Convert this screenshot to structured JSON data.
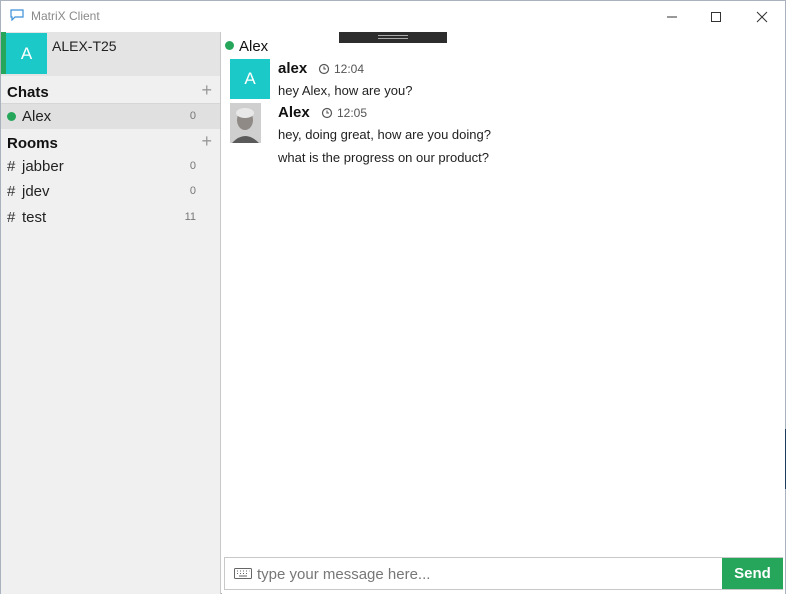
{
  "window": {
    "title": "MatriX Client"
  },
  "account": {
    "avatar_letter": "A",
    "name": "ALEX-T25"
  },
  "sidebar": {
    "chats_label": "Chats",
    "rooms_label": "Rooms",
    "add_symbol": "+",
    "chats": [
      {
        "name": "Alex",
        "count": "0",
        "online": true
      }
    ],
    "rooms": [
      {
        "hash": "#",
        "name": "jabber",
        "count": "0"
      },
      {
        "hash": "#",
        "name": "jdev",
        "count": "0"
      },
      {
        "hash": "#",
        "name": "test",
        "count": "11"
      }
    ]
  },
  "chat": {
    "contact_name": "Alex",
    "messages": [
      {
        "avatar_letter": "A",
        "author": "alex",
        "time": "12:04",
        "lines": [
          "hey Alex, how are you?"
        ]
      },
      {
        "author": "Alex",
        "time": "12:05",
        "lines": [
          "hey, doing great, how are you doing?",
          "what is the progress on our product?"
        ]
      }
    ]
  },
  "composer": {
    "placeholder": "type your message here...",
    "value": "",
    "send_label": "Send"
  },
  "colors": {
    "accent_green": "#26a65b",
    "avatar_cyan": "#1cc9c9"
  },
  "icons": [
    "chat-bubble-icon",
    "minimize-icon",
    "maximize-icon",
    "close-icon",
    "clock-icon",
    "keyboard-icon",
    "plus-icon"
  ]
}
